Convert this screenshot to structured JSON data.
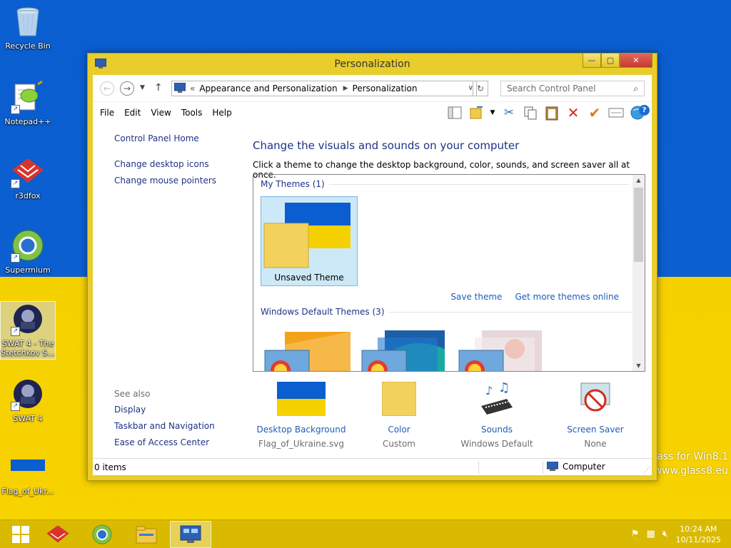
{
  "desktop": {
    "icons": [
      {
        "label": "Recycle Bin"
      },
      {
        "label": "Notepad++"
      },
      {
        "label": "r3dfox"
      },
      {
        "label": "Supermium"
      },
      {
        "label": "SWAT 4 - The Stetchkov S..."
      },
      {
        "label": "SWAT 4"
      },
      {
        "label": "Flag_of_Ukr..."
      }
    ],
    "watermark_line1": "lass for Win8.1",
    "watermark_line2": "www.glass8.eu"
  },
  "window": {
    "title": "Personalization",
    "breadcrumb_prefix": "«",
    "breadcrumb": [
      "Appearance and Personalization",
      "Personalization"
    ],
    "search_placeholder": "Search Control Panel",
    "menu": [
      "File",
      "Edit",
      "View",
      "Tools",
      "Help"
    ],
    "left_links": [
      "Control Panel Home",
      "Change desktop icons",
      "Change mouse pointers"
    ],
    "see_also_header": "See also",
    "see_also_links": [
      "Display",
      "Taskbar and Navigation",
      "Ease of Access Center"
    ],
    "main_title": "Change the visuals and sounds on your computer",
    "main_desc": "Click a theme to change the desktop background, color, sounds, and screen saver all at once.",
    "my_themes_header": "My Themes (1)",
    "unsaved_theme_label": "Unsaved Theme",
    "save_theme_link": "Save theme",
    "get_more_link": "Get more themes online",
    "default_themes_header": "Windows Default Themes (3)",
    "bottom_items": [
      {
        "label": "Desktop Background",
        "sub": "Flag_of_Ukraine.svg"
      },
      {
        "label": "Color",
        "sub": "Custom"
      },
      {
        "label": "Sounds",
        "sub": "Windows Default"
      },
      {
        "label": "Screen Saver",
        "sub": "None"
      }
    ],
    "status_count": "0 items",
    "status_location": "Computer"
  },
  "taskbar": {
    "time": "10:24 AM",
    "date": "10/11/2025"
  },
  "colors": {
    "flag_blue": "#0a5ed0",
    "flag_yellow": "#f6d100",
    "window_frame": "#e9cd2c",
    "link_blue": "#1e3287"
  }
}
